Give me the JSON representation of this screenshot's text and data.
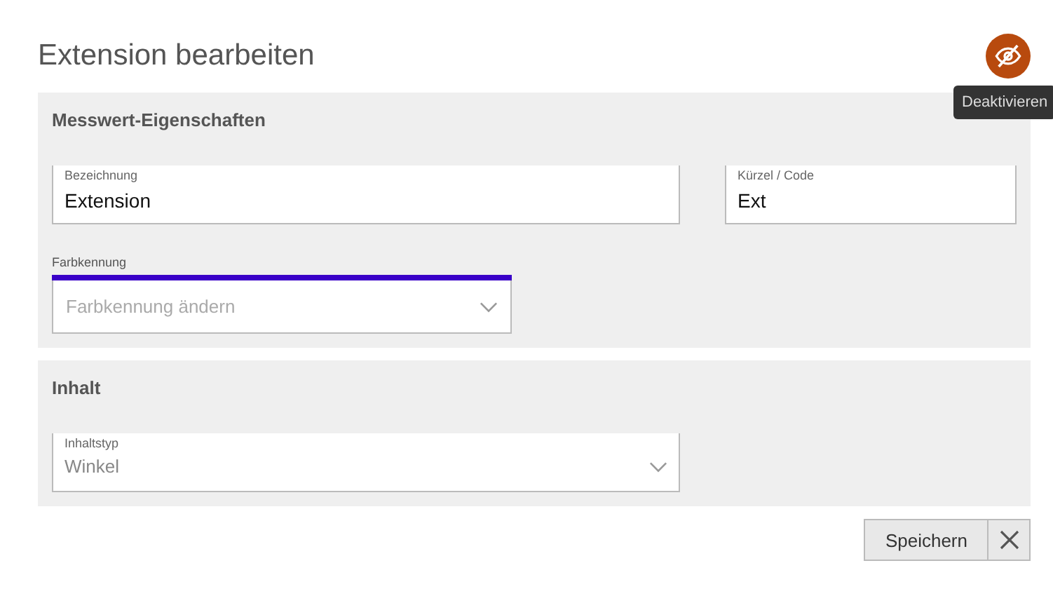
{
  "title": "Extension bearbeiten",
  "status_button": {
    "tooltip": "Deaktivieren"
  },
  "sections": [
    {
      "title": "Messwert-Eigenschaften",
      "rows": [
        [
          {
            "kind": "text",
            "label": "Bezeichnung",
            "value": "Extension"
          },
          {
            "kind": "text",
            "label": "Kürzel / Code",
            "value": "Ext"
          }
        ],
        [
          {
            "kind": "color",
            "label": "Farbkennung",
            "placeholder": "Farbkennung ändern",
            "color": "#3a00c8"
          }
        ]
      ]
    },
    {
      "title": "Inhalt",
      "rows": [
        [
          {
            "kind": "select",
            "label": "Inhaltstyp",
            "value": "Winkel"
          }
        ]
      ]
    }
  ],
  "buttons": {
    "save": "Speichern"
  }
}
